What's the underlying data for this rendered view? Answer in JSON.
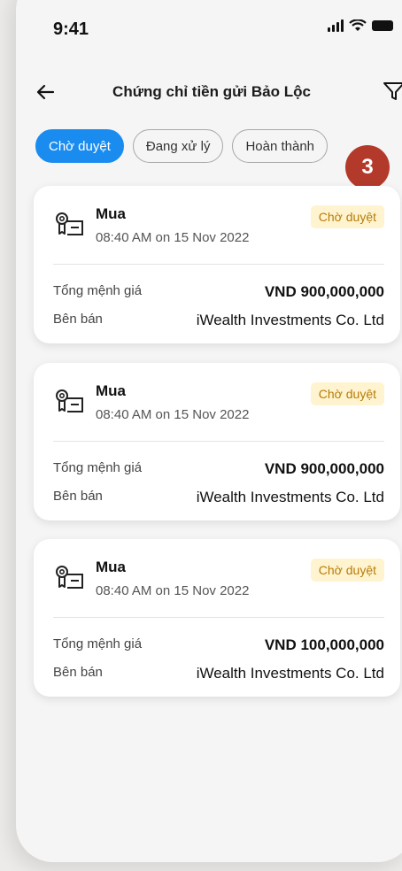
{
  "status_bar": {
    "time": "9:41"
  },
  "header": {
    "title": "Chứng chỉ tiền gửi Bảo Lộc"
  },
  "tabs": [
    {
      "label": "Chờ duyệt"
    },
    {
      "label": "Đang xử lý"
    },
    {
      "label": "Hoàn thành"
    }
  ],
  "step_badge": "3",
  "cards": [
    {
      "type": "Mua",
      "datetime": "08:40 AM on 15 Nov 2022",
      "status": "Chờ duyệt",
      "total_label": "Tổng mệnh giá",
      "total_value": "VND 900,000,000",
      "seller_label": "Bên bán",
      "seller_value": "iWealth Investments Co. Ltd"
    },
    {
      "type": "Mua",
      "datetime": "08:40 AM on 15 Nov 2022",
      "status": "Chờ duyệt",
      "total_label": "Tổng mệnh giá",
      "total_value": "VND 900,000,000",
      "seller_label": "Bên bán",
      "seller_value": "iWealth Investments Co. Ltd"
    },
    {
      "type": "Mua",
      "datetime": "08:40 AM on 15 Nov 2022",
      "status": "Chờ duyệt",
      "total_label": "Tổng mệnh giá",
      "total_value": "VND 100,000,000",
      "seller_label": "Bên bán",
      "seller_value": "iWealth Investments Co. Ltd"
    }
  ],
  "colors": {
    "accent": "#1a8cf0",
    "status_bg": "#fff4cf",
    "status_text": "#b77b08",
    "badge": "#b33a2b"
  },
  "icons": {
    "back": "arrow-left-icon",
    "filter": "filter-icon",
    "certificate": "certificate-icon"
  }
}
